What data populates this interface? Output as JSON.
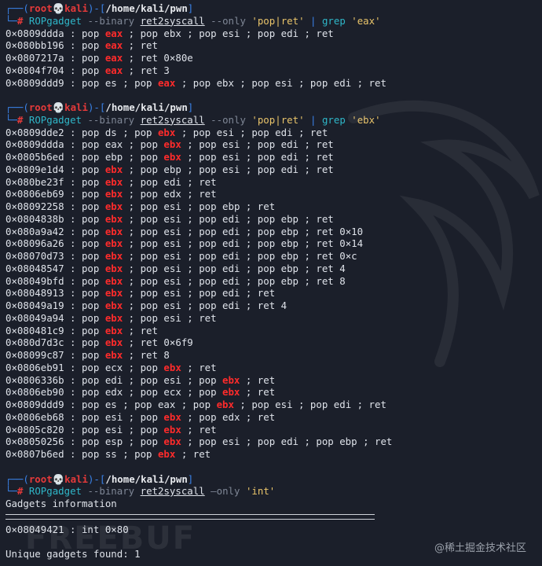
{
  "prompt": {
    "user": "root",
    "skull": "💀",
    "host": "kali",
    "path": "/home/kali/pwn",
    "corner1": "┌──(",
    "mid": ")-[",
    "end": "]",
    "corner2": "└─",
    "hash": "#"
  },
  "blocks": [
    {
      "command": {
        "tool": "ROPgadget",
        "flag1": "--binary",
        "file": "ret2syscall",
        "flag2": "--only",
        "only": "'pop|ret'",
        "pipe": "|",
        "grep": "grep",
        "pattern": "'eax'"
      },
      "highlight": "eax",
      "lines": [
        "0×0809ddda : pop eax ; pop ebx ; pop esi ; pop edi ; ret",
        "0×080bb196 : pop eax ; ret",
        "0×0807217a : pop eax ; ret 0×80e",
        "0×0804f704 : pop eax ; ret 3",
        "0×0809ddd9 : pop es ; pop eax ; pop ebx ; pop esi ; pop edi ; ret"
      ]
    },
    {
      "command": {
        "tool": "ROPgadget",
        "flag1": "--binary",
        "file": "ret2syscall",
        "flag2": "--only",
        "only": "'pop|ret'",
        "pipe": "|",
        "grep": "grep",
        "pattern": "'ebx'"
      },
      "highlight": "ebx",
      "lines": [
        "0×0809dde2 : pop ds ; pop ebx ; pop esi ; pop edi ; ret",
        "0×0809ddda : pop eax ; pop ebx ; pop esi ; pop edi ; ret",
        "0×0805b6ed : pop ebp ; pop ebx ; pop esi ; pop edi ; ret",
        "0×0809e1d4 : pop ebx ; pop ebp ; pop esi ; pop edi ; ret",
        "0×080be23f : pop ebx ; pop edi ; ret",
        "0×0806eb69 : pop ebx ; pop edx ; ret",
        "0×08092258 : pop ebx ; pop esi ; pop ebp ; ret",
        "0×0804838b : pop ebx ; pop esi ; pop edi ; pop ebp ; ret",
        "0×080a9a42 : pop ebx ; pop esi ; pop edi ; pop ebp ; ret 0×10",
        "0×08096a26 : pop ebx ; pop esi ; pop edi ; pop ebp ; ret 0×14",
        "0×08070d73 : pop ebx ; pop esi ; pop edi ; pop ebp ; ret 0×c",
        "0×08048547 : pop ebx ; pop esi ; pop edi ; pop ebp ; ret 4",
        "0×08049bfd : pop ebx ; pop esi ; pop edi ; pop ebp ; ret 8",
        "0×08048913 : pop ebx ; pop esi ; pop edi ; ret",
        "0×08049a19 : pop ebx ; pop esi ; pop edi ; ret 4",
        "0×08049a94 : pop ebx ; pop esi ; ret",
        "0×080481c9 : pop ebx ; ret",
        "0×080d7d3c : pop ebx ; ret 0×6f9",
        "0×08099c87 : pop ebx ; ret 8",
        "0×0806eb91 : pop ecx ; pop ebx ; ret",
        "0×0806336b : pop edi ; pop esi ; pop ebx ; ret",
        "0×0806eb90 : pop edx ; pop ecx ; pop ebx ; ret",
        "0×0809ddd9 : pop es ; pop eax ; pop ebx ; pop esi ; pop edi ; ret",
        "0×0806eb68 : pop esi ; pop ebx ; pop edx ; ret",
        "0×0805c820 : pop esi ; pop ebx ; ret",
        "0×08050256 : pop esp ; pop ebx ; pop esi ; pop edi ; pop ebp ; ret",
        "0×0807b6ed : pop ss ; pop ebx ; ret"
      ]
    }
  ],
  "block3": {
    "command": {
      "tool": "ROPgadget",
      "flag1": "--binary",
      "file": "ret2syscall",
      "flag2": "—only",
      "only": "'int'"
    },
    "header": "Gadgets information",
    "line": "0×08049421 : int 0×80",
    "footer": "Unique gadgets found: 1"
  },
  "watermark": "@稀土掘金技术社区",
  "ghost_logo": "FREEBUF",
  "colors": {
    "background": "#1b1f2a",
    "highlight": "#ff2b2b",
    "prompt_blue": "#3a82e8",
    "command_cyan": "#2fb7c9",
    "string_yellow": "#e9c46a"
  }
}
